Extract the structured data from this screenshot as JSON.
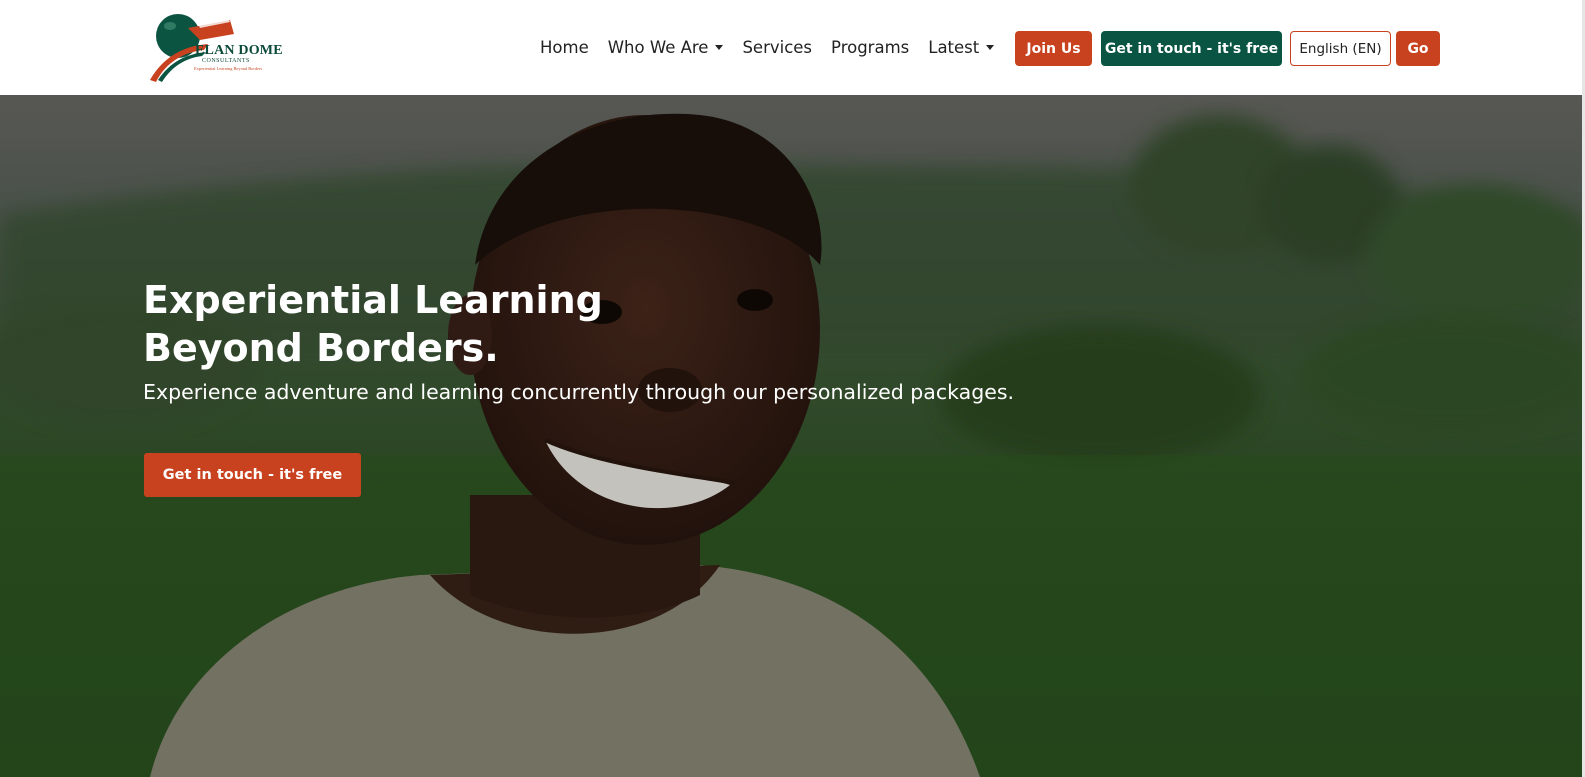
{
  "header": {
    "logo": {
      "name": "ELAN DOME",
      "subtitle": "CONSULTANTS",
      "tagline": "Experiential Learning Beyond Borders"
    },
    "nav": [
      {
        "label": "Home",
        "dropdown": false
      },
      {
        "label": "Who We Are",
        "dropdown": true
      },
      {
        "label": "Services",
        "dropdown": false
      },
      {
        "label": "Programs",
        "dropdown": false
      },
      {
        "label": "Latest",
        "dropdown": true
      }
    ],
    "join_label": "Join Us",
    "contact_label": "Get in touch - it's free",
    "language_label": "English (EN)",
    "go_label": "Go"
  },
  "hero": {
    "title": "Experiential Learning Beyond Borders.",
    "subtitle": "Experience adventure and learning concurrently through our personalized packages.",
    "cta_label": "Get in touch - it's free"
  },
  "colors": {
    "accent": "#c9421f",
    "brand_green": "#0a5444"
  }
}
